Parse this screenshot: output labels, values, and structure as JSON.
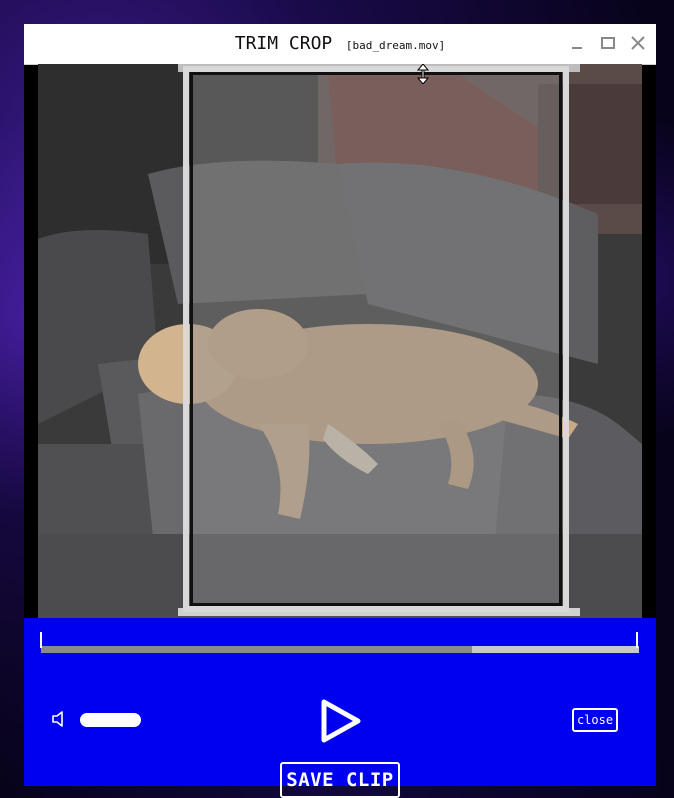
{
  "window": {
    "title": "TRIM CROP",
    "filename": "[bad_dream.mov]"
  },
  "icons": {
    "minimize": "minimize-icon",
    "maximize": "maximize-icon",
    "close": "close-icon",
    "resize": "vertical-resize-icon",
    "volume": "speaker-icon",
    "play": "play-icon"
  },
  "video": {
    "subject": "sleeping dog on couch"
  },
  "timeline": {
    "progress": 0.72
  },
  "controls": {
    "close_label": "close",
    "save_label": "SAVE CLIP"
  },
  "colors": {
    "control_panel": "#0000f0",
    "titlebar": "#ffffff",
    "crop_frame": "#d8d8d8"
  }
}
